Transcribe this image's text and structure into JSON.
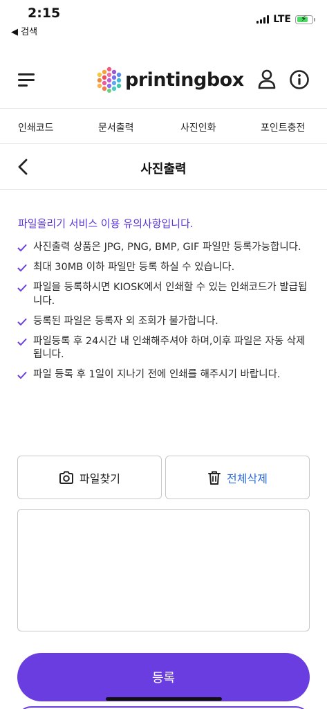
{
  "status_bar": {
    "time": "2:15",
    "back_label": "◀ 검색",
    "network": "LTE"
  },
  "header": {
    "logo_text": "printingbox"
  },
  "nav_tabs": [
    {
      "label": "인쇄코드"
    },
    {
      "label": "문서출력"
    },
    {
      "label": "사진인화"
    },
    {
      "label": "포인트충전"
    }
  ],
  "page": {
    "title": "사진출력"
  },
  "notice": {
    "heading": "파일올리기 서비스 이용 유의사항입니다.",
    "items": [
      "사진출력 상품은 JPG, PNG, BMP, GIF 파일만 등록가능합니다.",
      "최대 30MB 이하 파일만 등록 하실 수 있습니다.",
      "파일을 등록하시면 KIOSK에서 인쇄할 수 있는 인쇄코드가 발급됩니다.",
      "등록된 파일은 등록자 외 조회가 불가합니다.",
      "파일등록 후 24시간 내 인쇄해주셔야 하며,이후 파일은 자동 삭제됩니다.",
      "파일 등록 후 1일이 지나기 전에 인쇄를 해주시기 바랍니다."
    ]
  },
  "actions": {
    "find_file_label": "파일찾기",
    "delete_all_label": "전체삭제",
    "register_label": "등록"
  },
  "colors": {
    "accent": "#6a3de0",
    "notice_heading": "#5b35d5",
    "delete_text": "#2e6bd8",
    "battery": "#4cd964"
  },
  "icons": {
    "menu": "hamburger-icon",
    "user": "user-icon",
    "info": "info-icon",
    "back": "chevron-left-icon",
    "check": "check-icon",
    "camera": "camera-icon",
    "trash": "trash-icon"
  }
}
